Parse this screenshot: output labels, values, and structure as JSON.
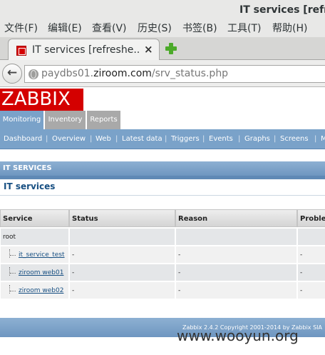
{
  "window": {
    "title": "IT services [refre"
  },
  "menubar": [
    {
      "label": "文件(F)"
    },
    {
      "label": "编辑(E)"
    },
    {
      "label": "查看(V)"
    },
    {
      "label": "历史(S)"
    },
    {
      "label": "书签(B)"
    },
    {
      "label": "工具(T)"
    },
    {
      "label": "帮助(H)"
    }
  ],
  "tab": {
    "title": "IT services [refreshe...",
    "close": "×",
    "favicon": "zabbix-favicon-icon",
    "newtab_icon": "plus-icon"
  },
  "navbar": {
    "back_icon": "back-arrow-icon",
    "url_prefix": "paydbs01.",
    "url_domain": "ziroom.com",
    "url_path": "/srv_status.php"
  },
  "zabbix": {
    "logo": "ZABBIX",
    "main_menu": [
      {
        "label": "Monitoring",
        "active": true
      },
      {
        "label": "Inventory",
        "active": false
      },
      {
        "label": "Reports",
        "active": false
      }
    ],
    "sub_menu": [
      "Dashboard",
      "Overview",
      "Web",
      "Latest data",
      "Triggers",
      "Events",
      "Graphs",
      "Screens",
      "M"
    ],
    "section_header": "IT SERVICES",
    "subtitle": "IT services",
    "table": {
      "columns": [
        "Service",
        "Status",
        "Reason",
        "Proble"
      ],
      "rows": [
        {
          "service": "root",
          "status": "",
          "reason": "",
          "problem": "",
          "link": false
        },
        {
          "service": "it_service_test",
          "status": "-",
          "reason": "-",
          "problem": "-",
          "link": true
        },
        {
          "service": "ziroom web01",
          "status": "-",
          "reason": "-",
          "problem": "-",
          "link": true
        },
        {
          "service": "ziroom web02",
          "status": "-",
          "reason": "-",
          "problem": "-",
          "link": true
        }
      ]
    },
    "footer": "Zabbix 2.4.2 Copyright 2001-2014 by Zabbix SIA"
  },
  "watermark": "www.wooyun.org",
  "colors": {
    "brand": "#d40000",
    "menu_active": "#7aa2c9",
    "link": "#174f82"
  }
}
